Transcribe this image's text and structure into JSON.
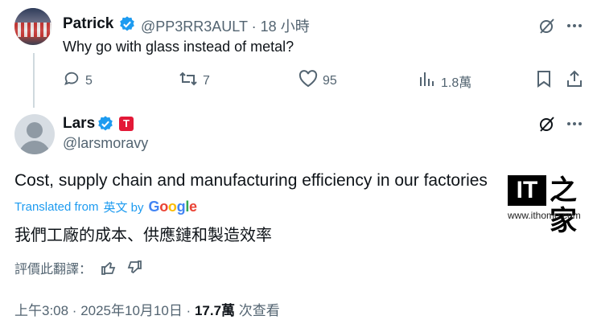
{
  "reply": {
    "name": "Patrick",
    "handle": "@PP3RR3AULT",
    "time": "· 18 小時",
    "text": "Why go with glass instead of metal?",
    "stats": {
      "replies": "5",
      "reposts": "7",
      "likes": "95",
      "views": "1.8萬"
    }
  },
  "main": {
    "name": "Lars",
    "affiliate_badge": "T",
    "handle": "@larsmoravy",
    "text": "Cost, supply chain and manufacturing efficiency in our factories",
    "translated_prefix": "Translated from",
    "translated_lang": "英文 by",
    "google": [
      "G",
      "o",
      "o",
      "g",
      "l",
      "e"
    ],
    "translation": "我們工廠的成本、供應鏈和製造效率",
    "rate_label": "評價此翻譯：",
    "timestamp": "上午3:08 · 2025年10月10日 · ",
    "views": "17.7萬",
    "views_label": " 次查看"
  },
  "watermark": {
    "it": "IT",
    "cn": "之家",
    "url": "www.ithome.com"
  },
  "colors": {
    "accent": "#1d9bf0",
    "muted": "#536471",
    "tesla": "#e31937"
  }
}
